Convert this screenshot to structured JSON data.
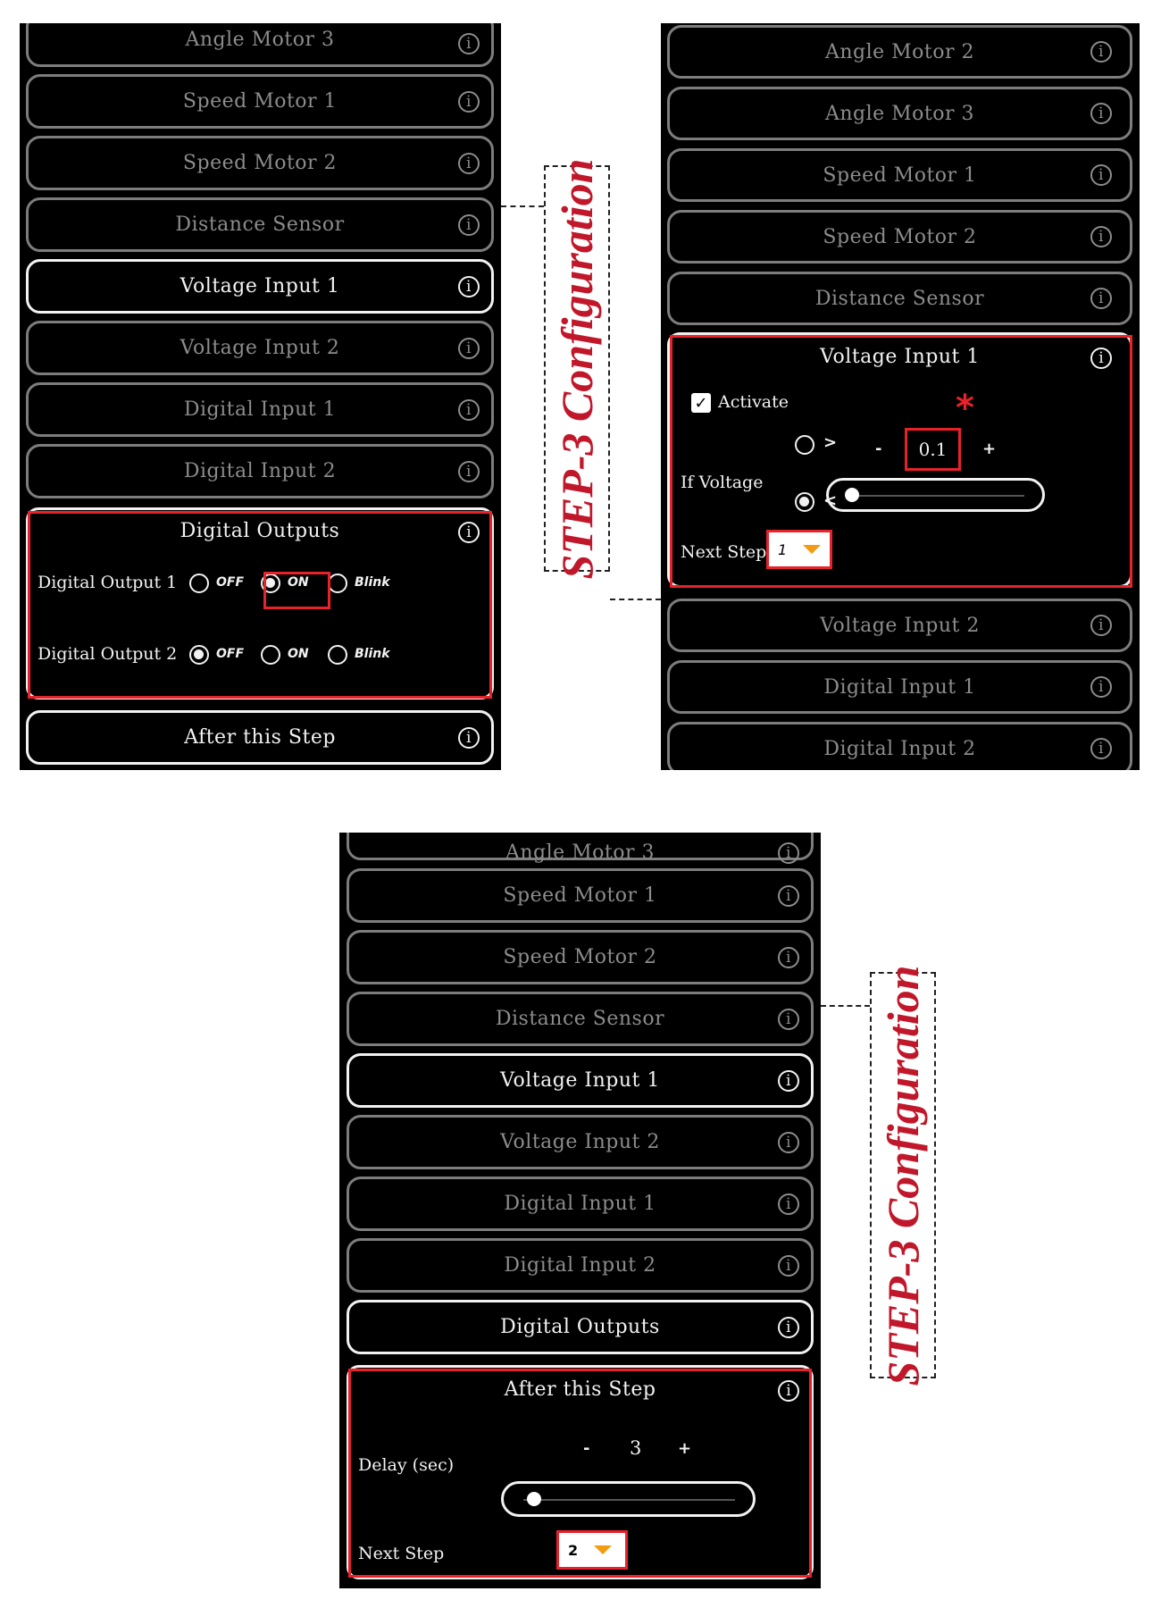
{
  "left_panel": {
    "rows": [
      {
        "label": "Angle Motor 3",
        "state": "inactive"
      },
      {
        "label": "Speed Motor 1",
        "state": "inactive"
      },
      {
        "label": "Speed Motor 2",
        "state": "inactive"
      },
      {
        "label": "Distance Sensor",
        "state": "inactive"
      },
      {
        "label": "Voltage Input 1",
        "state": "active"
      },
      {
        "label": "Voltage Input 2",
        "state": "inactive"
      },
      {
        "label": "Digital Input 1",
        "state": "inactive"
      },
      {
        "label": "Digital Input 2",
        "state": "inactive"
      }
    ],
    "digital_outputs": {
      "title": "Digital Outputs",
      "outputs": [
        {
          "label": "Digital Output 1",
          "options": [
            "OFF",
            "ON",
            "Blink"
          ],
          "selected": "ON"
        },
        {
          "label": "Digital Output 2",
          "options": [
            "OFF",
            "ON",
            "Blink"
          ],
          "selected": "OFF"
        }
      ]
    },
    "after_row": {
      "label": "After this Step"
    }
  },
  "right_panel": {
    "rows_above": [
      {
        "label": "Angle Motor 2"
      },
      {
        "label": "Angle Motor 3"
      },
      {
        "label": "Speed Motor 1"
      },
      {
        "label": "Speed Motor 2"
      },
      {
        "label": "Distance Sensor"
      }
    ],
    "voltage_input": {
      "title": "Voltage Input 1",
      "activate_label": "Activate",
      "activate_checked": true,
      "check_glyph": "✓",
      "if_label": "If Voltage",
      "greater_label": ">",
      "less_label": "<",
      "comparison_selected": "<",
      "minus": "-",
      "plus": "+",
      "value": "0.1",
      "slider_fraction": 0.02,
      "next_step_label": "Next Step",
      "next_step_value": "1",
      "asterisk": "*"
    },
    "rows_below": [
      {
        "label": "Voltage Input 2"
      },
      {
        "label": "Digital Input 1"
      },
      {
        "label": "Digital Input 2"
      }
    ]
  },
  "bottom_panel": {
    "rows": [
      {
        "label": "Angle Motor 3",
        "state": "inactive"
      },
      {
        "label": "Speed Motor 1",
        "state": "inactive"
      },
      {
        "label": "Speed Motor 2",
        "state": "inactive"
      },
      {
        "label": "Distance Sensor",
        "state": "inactive"
      },
      {
        "label": "Voltage Input 1",
        "state": "active"
      },
      {
        "label": "Voltage Input 2",
        "state": "inactive"
      },
      {
        "label": "Digital Input 1",
        "state": "inactive"
      },
      {
        "label": "Digital Input 2",
        "state": "inactive"
      },
      {
        "label": "Digital Outputs",
        "state": "active"
      }
    ],
    "after_step": {
      "title": "After this Step",
      "delay_label": "Delay (sec)",
      "minus": "-",
      "plus": "+",
      "delay_value": "3",
      "slider_fraction": 0.05,
      "next_step_label": "Next Step",
      "next_step_value": "2"
    }
  },
  "annotations": {
    "step_label": "STEP-3 Configuration"
  },
  "icons": {
    "info": "i"
  },
  "colors": {
    "highlight_red": "#e8222b",
    "annotation_red": "#c0182a",
    "caret_orange": "#f39c12"
  }
}
